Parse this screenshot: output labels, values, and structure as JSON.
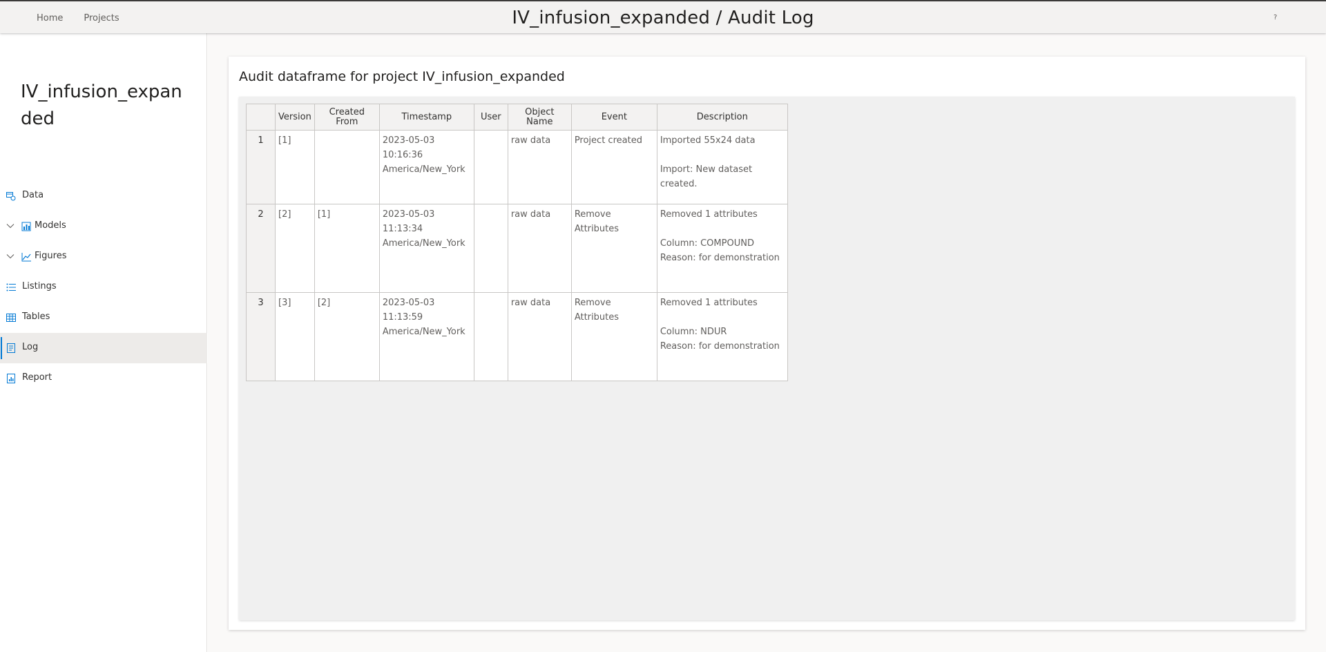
{
  "header": {
    "nav": [
      "Home",
      "Projects"
    ],
    "title": "IV_infusion_expanded / Audit Log",
    "help": "?"
  },
  "sidebar": {
    "project_name": "IV_infusion_expanded",
    "items": [
      {
        "label": "Data",
        "icon": "data-icon"
      },
      {
        "label": "Models",
        "icon": "models-icon",
        "expandable": true
      },
      {
        "label": "Figures",
        "icon": "figures-icon",
        "expandable": true
      },
      {
        "label": "Listings",
        "icon": "listings-icon"
      },
      {
        "label": "Tables",
        "icon": "tables-icon"
      },
      {
        "label": "Log",
        "icon": "log-icon",
        "active": true
      },
      {
        "label": "Report",
        "icon": "report-icon"
      }
    ]
  },
  "main": {
    "card_title": "Audit dataframe for project IV_infusion_expanded",
    "table": {
      "headers": [
        "",
        "Version",
        "Created From",
        "Timestamp",
        "User",
        "Object Name",
        "Event",
        "Description"
      ],
      "rows": [
        {
          "idx": "1",
          "version": "[1]",
          "created_from": "",
          "timestamp": "2023-05-03 10:16:36\nAmerica/New_York",
          "user": "",
          "object_name": "raw data",
          "event": "Project created",
          "description": "Imported 55x24 data\n\nImport: New dataset created."
        },
        {
          "idx": "2",
          "version": "[2]",
          "created_from": "[1]",
          "timestamp": "2023-05-03 11:13:34\nAmerica/New_York",
          "user": "",
          "object_name": "raw data",
          "event": "Remove Attributes",
          "description": "Removed 1 attributes\n\nColumn: COMPOUND\nReason: for demonstration"
        },
        {
          "idx": "3",
          "version": "[3]",
          "created_from": "[2]",
          "timestamp": "2023-05-03 11:13:59\nAmerica/New_York",
          "user": "",
          "object_name": "raw data",
          "event": "Remove Attributes",
          "description": "Removed 1 attributes\n\nColumn: NDUR\nReason: for demonstration"
        }
      ]
    }
  },
  "colors": {
    "accent": "#0078d4",
    "active_bg": "#edebe9",
    "header_bg": "#f3f2f1"
  }
}
